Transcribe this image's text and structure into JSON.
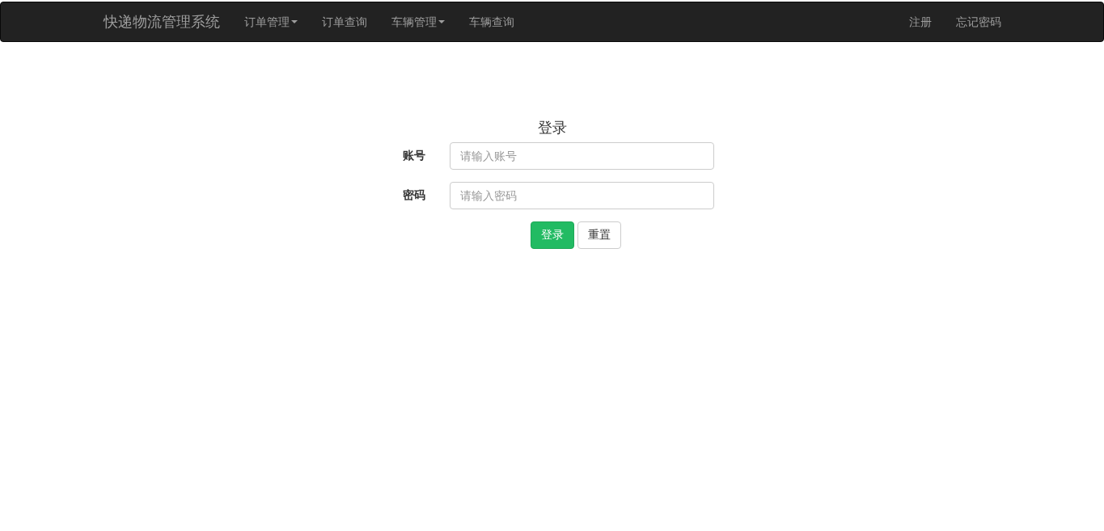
{
  "navbar": {
    "brand": "快递物流管理系统",
    "items": [
      {
        "label": "订单管理",
        "kind": "dropdown"
      },
      {
        "label": "订单查询",
        "kind": "link"
      },
      {
        "label": "车辆管理",
        "kind": "dropdown"
      },
      {
        "label": "车辆查询",
        "kind": "link"
      }
    ],
    "right_items": [
      {
        "label": "注册"
      },
      {
        "label": "忘记密码"
      }
    ]
  },
  "login_form": {
    "title": "登录",
    "fields": [
      {
        "label": "账号",
        "placeholder": "请输入账号"
      },
      {
        "label": "密码",
        "placeholder": "请输入密码"
      }
    ],
    "buttons": [
      {
        "label": "登录",
        "kind": "primary"
      },
      {
        "label": "重置",
        "kind": "default"
      }
    ]
  }
}
